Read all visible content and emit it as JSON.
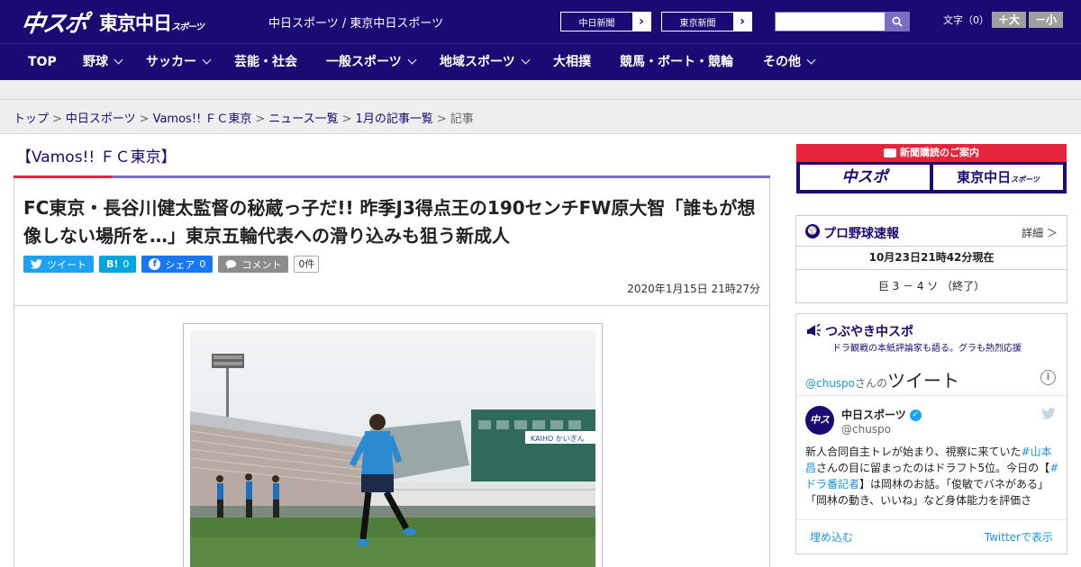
{
  "header": {
    "logo_main": "中スポ",
    "logo_tokyo": "東京中日",
    "logo_tokyo_small": "スポーツ",
    "site_name": "中日スポーツ / 東京中日スポーツ",
    "btn_chunichi": "中日新聞",
    "btn_tokyo": "東京新聞",
    "search_placeholder": "",
    "font_label": "文字（0）",
    "font_larger": "＋大",
    "font_smaller": "－小"
  },
  "nav": {
    "items": [
      {
        "label": "TOP",
        "dropdown": false
      },
      {
        "label": "野球",
        "dropdown": true
      },
      {
        "label": "サッカー",
        "dropdown": true
      },
      {
        "label": "芸能・社会",
        "dropdown": false
      },
      {
        "label": "一般スポーツ",
        "dropdown": true
      },
      {
        "label": "地域スポーツ",
        "dropdown": true
      },
      {
        "label": "大相撲",
        "dropdown": false
      },
      {
        "label": "競馬・ボート・競輪",
        "dropdown": false
      },
      {
        "label": "その他",
        "dropdown": true
      }
    ]
  },
  "breadcrumb": [
    "トップ",
    "中日スポーツ",
    "Vamos!! ＦＣ東京",
    "ニュース一覧",
    "1月の記事一覧"
  ],
  "breadcrumb_current": "記事",
  "article": {
    "section": "【Vamos!! ＦＣ東京】",
    "headline": "FC東京・長谷川健太監督の秘蔵っ子だ!! 昨季J3得点王の190センチFW原大智「誰もが想像しない場所を…」東京五輪代表への滑り込みも狙う新成人",
    "share_tweet": "ツイート",
    "share_hatena_glyph": "B!",
    "share_hatena_count": "0",
    "share_facebook": "シェア",
    "share_facebook_count": "0",
    "share_comment": "コメント",
    "comment_count": "0件",
    "date": "2020年1月15日 21時27分"
  },
  "sidebar": {
    "subscribe_title": "新聞購読のご案内",
    "subscribe_chuspo": "中スポ",
    "subscribe_tokyo": "東京中日",
    "subscribe_tokyo_small": "スポーツ",
    "baseball_title": "プロ野球速報",
    "baseball_more": "詳細 ＞",
    "baseball_time": "10月23日21時42分現在",
    "baseball_score": "巨 3 － 4 ソ （終了）",
    "tsubuyaki_title": "つぶやき中スポ",
    "tsubuyaki_sub": "ドラ観戦の本紙評論家も語る。グラも熱烈応援",
    "tw_handle_link": "@chuspo",
    "tw_san": "さんの",
    "tw_tweet_word": "ツイート",
    "tw_user": "中日スポーツ",
    "tw_screen": "@chuspo",
    "tw_avatar": "中スポ",
    "tw_text_1": "新人合同自主トレが始まり、視察に来ていた",
    "tw_tag_1": "#山本昌",
    "tw_text_2": "さんの目に留まったのはドラフト5位。今日の【",
    "tw_tag_2": "#ドラ番記者",
    "tw_text_3": "】は岡林のお話。「俊敏でバネがある」「岡林の動き、いいね」など身体能力を評価さ",
    "tw_embed": "埋め込む",
    "tw_view": "Twitterで表示"
  },
  "colors": {
    "brand_navy": "#1a0a73",
    "accent_red": "#e8243c",
    "accent_purple": "#7a6ec2",
    "twitter_blue": "#1da1f2",
    "hatena_blue": "#00a4de",
    "facebook_blue": "#1877f2",
    "comment_gray": "#8c8c8c"
  }
}
